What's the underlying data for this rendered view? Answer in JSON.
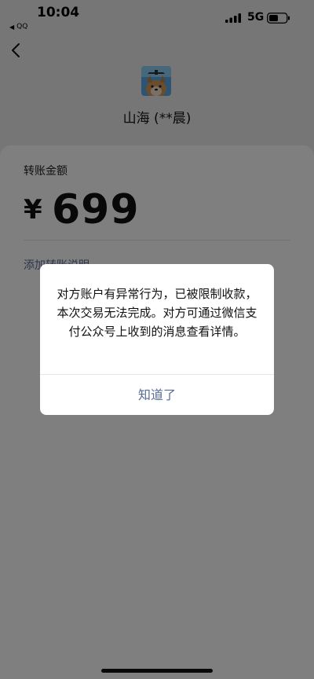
{
  "status_bar": {
    "time": "10:04",
    "back_app_label": "QQ",
    "network": "5G",
    "icons": [
      "signal-icon",
      "battery-icon"
    ]
  },
  "nav": {
    "back_icon": "chevron-left-icon"
  },
  "recipient": {
    "name": "山海 (**晨)",
    "avatar": "dog-avatar-with-airplane"
  },
  "transfer": {
    "amount_label": "转账金额",
    "currency": "¥",
    "amount": "699",
    "add_note": "添加转账说明"
  },
  "alert": {
    "message": "对方账户有异常行为，已被限制收款，本次交易无法完成。对方可通过微信支付公众号上收到的消息查看详情。",
    "ok_label": "知道了"
  },
  "colors": {
    "link": "#576b95",
    "mask": "rgba(0,0,0,0.5)",
    "page_bg": "#ededed"
  }
}
